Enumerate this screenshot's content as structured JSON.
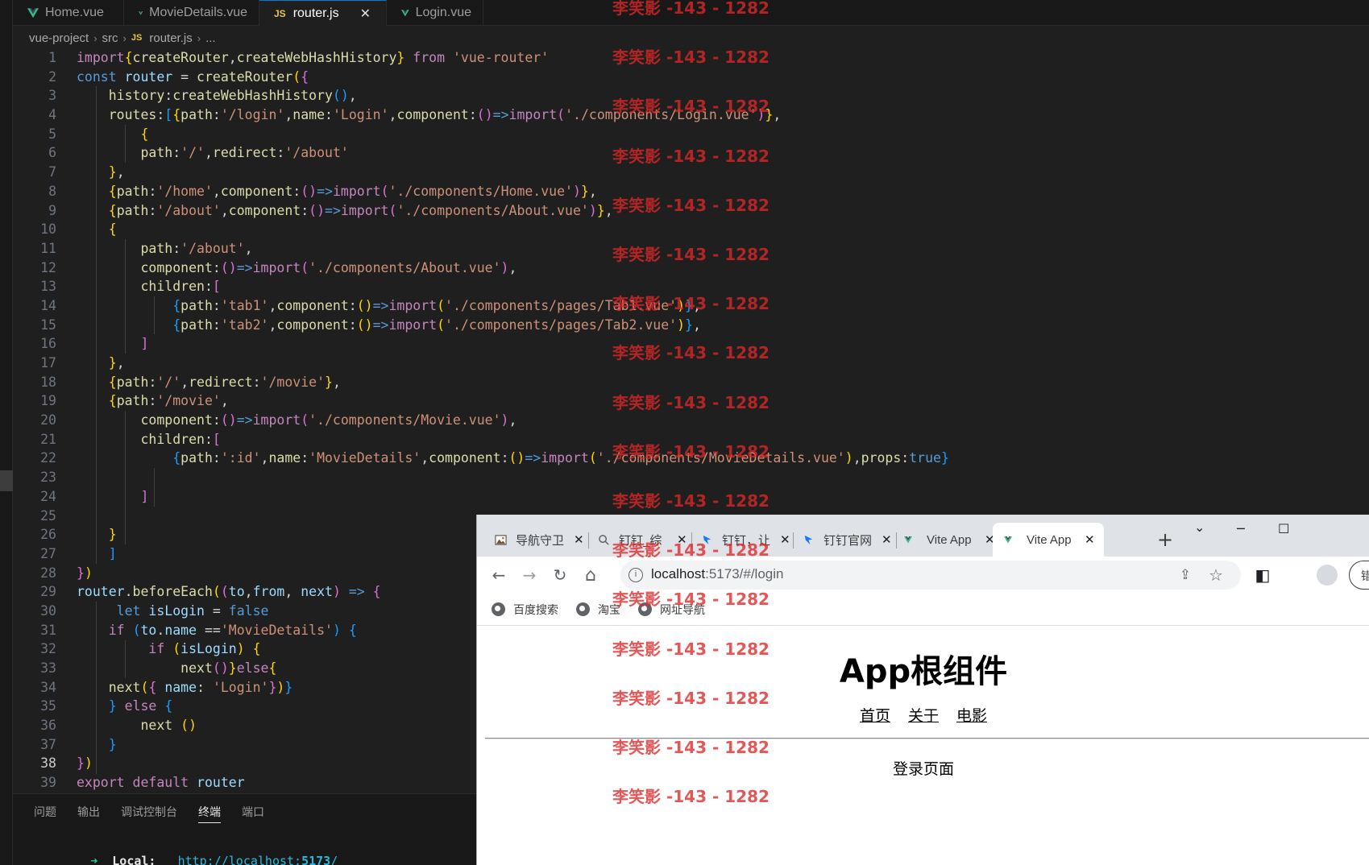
{
  "editor": {
    "tabs": [
      {
        "label": "Home.vue",
        "type": "vue",
        "active": false
      },
      {
        "label": "MovieDetails.vue",
        "type": "vue",
        "active": false
      },
      {
        "label": "router.js",
        "type": "js",
        "active": true
      },
      {
        "label": "Login.vue",
        "type": "vue",
        "active": false
      }
    ],
    "js_badge": "JS",
    "close_glyph": "✕",
    "breadcrumb": [
      "vue-project",
      "src",
      "router.js",
      "..."
    ],
    "breadcrumb_sep": "›",
    "current_line": 38,
    "lines": [
      [
        [
          "kw",
          "import"
        ],
        [
          "p1",
          "{"
        ],
        [
          "fn",
          "createRouter"
        ],
        [
          "op",
          ","
        ],
        [
          "fn",
          "createWebHashHistory"
        ],
        [
          "p1",
          "}"
        ],
        [
          "op",
          " "
        ],
        [
          "kw",
          "from"
        ],
        [
          "op",
          " "
        ],
        [
          "str",
          "'vue-router'"
        ]
      ],
      [
        [
          "var",
          "const"
        ],
        [
          "op",
          " "
        ],
        [
          "v",
          "router"
        ],
        [
          "op",
          " = "
        ],
        [
          "fn",
          "createRouter"
        ],
        [
          "p1",
          "("
        ],
        [
          "p2",
          "{"
        ]
      ],
      [
        [
          "op",
          "    "
        ],
        [
          "fn",
          "history"
        ],
        [
          "op",
          ":"
        ],
        [
          "fn",
          "createWebHashHistory"
        ],
        [
          "p3",
          "()"
        ],
        [
          "op",
          ","
        ]
      ],
      [
        [
          "op",
          "    "
        ],
        [
          "fn",
          "routes"
        ],
        [
          "op",
          ":"
        ],
        [
          "p3",
          "["
        ],
        [
          "p1",
          "{"
        ],
        [
          "fn",
          "path"
        ],
        [
          "op",
          ":"
        ],
        [
          "str",
          "'/login'"
        ],
        [
          "op",
          ","
        ],
        [
          "fn",
          "name"
        ],
        [
          "op",
          ":"
        ],
        [
          "str",
          "'Login'"
        ],
        [
          "op",
          ","
        ],
        [
          "fn",
          "component"
        ],
        [
          "op",
          ":"
        ],
        [
          "p2",
          "()"
        ],
        [
          "ar",
          "=>"
        ],
        [
          "kw",
          "import"
        ],
        [
          "p2",
          "("
        ],
        [
          "str",
          "'./components/Login.vue'"
        ],
        [
          "p2",
          ")"
        ],
        [
          "p1",
          "}"
        ],
        [
          "op",
          ","
        ]
      ],
      [
        [
          "op",
          "        "
        ],
        [
          "p1",
          "{"
        ]
      ],
      [
        [
          "op",
          "        "
        ],
        [
          "fn",
          "path"
        ],
        [
          "op",
          ":"
        ],
        [
          "str",
          "'/'"
        ],
        [
          "op",
          ","
        ],
        [
          "fn",
          "redirect"
        ],
        [
          "op",
          ":"
        ],
        [
          "str",
          "'/about'"
        ]
      ],
      [
        [
          "op",
          "    "
        ],
        [
          "p1",
          "}"
        ],
        [
          "op",
          ","
        ]
      ],
      [
        [
          "op",
          "    "
        ],
        [
          "p1",
          "{"
        ],
        [
          "fn",
          "path"
        ],
        [
          "op",
          ":"
        ],
        [
          "str",
          "'/home'"
        ],
        [
          "op",
          ","
        ],
        [
          "fn",
          "component"
        ],
        [
          "op",
          ":"
        ],
        [
          "p2",
          "()"
        ],
        [
          "ar",
          "=>"
        ],
        [
          "kw",
          "import"
        ],
        [
          "p2",
          "("
        ],
        [
          "str",
          "'./components/Home.vue'"
        ],
        [
          "p2",
          ")"
        ],
        [
          "p1",
          "}"
        ],
        [
          "op",
          ","
        ]
      ],
      [
        [
          "op",
          "    "
        ],
        [
          "p1",
          "{"
        ],
        [
          "fn",
          "path"
        ],
        [
          "op",
          ":"
        ],
        [
          "str",
          "'/about'"
        ],
        [
          "op",
          ","
        ],
        [
          "fn",
          "component"
        ],
        [
          "op",
          ":"
        ],
        [
          "p2",
          "()"
        ],
        [
          "ar",
          "=>"
        ],
        [
          "kw",
          "import"
        ],
        [
          "p2",
          "("
        ],
        [
          "str",
          "'./components/About.vue'"
        ],
        [
          "p2",
          ")"
        ],
        [
          "p1",
          "}"
        ],
        [
          "op",
          ","
        ]
      ],
      [
        [
          "op",
          "    "
        ],
        [
          "p1",
          "{"
        ]
      ],
      [
        [
          "op",
          "        "
        ],
        [
          "fn",
          "path"
        ],
        [
          "op",
          ":"
        ],
        [
          "str",
          "'/about'"
        ],
        [
          "op",
          ","
        ]
      ],
      [
        [
          "op",
          "        "
        ],
        [
          "fn",
          "component"
        ],
        [
          "op",
          ":"
        ],
        [
          "p2",
          "()"
        ],
        [
          "ar",
          "=>"
        ],
        [
          "kw",
          "import"
        ],
        [
          "p2",
          "("
        ],
        [
          "str",
          "'./components/About.vue'"
        ],
        [
          "p2",
          ")"
        ],
        [
          "op",
          ","
        ]
      ],
      [
        [
          "op",
          "        "
        ],
        [
          "fn",
          "children"
        ],
        [
          "op",
          ":"
        ],
        [
          "p2",
          "["
        ]
      ],
      [
        [
          "op",
          "            "
        ],
        [
          "p3",
          "{"
        ],
        [
          "fn",
          "path"
        ],
        [
          "op",
          ":"
        ],
        [
          "str",
          "'tab1'"
        ],
        [
          "op",
          ","
        ],
        [
          "fn",
          "component"
        ],
        [
          "op",
          ":"
        ],
        [
          "p1",
          "()"
        ],
        [
          "ar",
          "=>"
        ],
        [
          "kw",
          "import"
        ],
        [
          "p1",
          "("
        ],
        [
          "str",
          "'./components/pages/Tab1.vue'"
        ],
        [
          "p1",
          ")"
        ],
        [
          "p3",
          "}"
        ],
        [
          "op",
          ","
        ]
      ],
      [
        [
          "op",
          "            "
        ],
        [
          "p3",
          "{"
        ],
        [
          "fn",
          "path"
        ],
        [
          "op",
          ":"
        ],
        [
          "str",
          "'tab2'"
        ],
        [
          "op",
          ","
        ],
        [
          "fn",
          "component"
        ],
        [
          "op",
          ":"
        ],
        [
          "p1",
          "()"
        ],
        [
          "ar",
          "=>"
        ],
        [
          "kw",
          "import"
        ],
        [
          "p1",
          "("
        ],
        [
          "str",
          "'./components/pages/Tab2.vue'"
        ],
        [
          "p1",
          ")"
        ],
        [
          "p3",
          "}"
        ],
        [
          "op",
          ","
        ]
      ],
      [
        [
          "op",
          "        "
        ],
        [
          "p2",
          "]"
        ]
      ],
      [
        [
          "op",
          "    "
        ],
        [
          "p1",
          "}"
        ],
        [
          "op",
          ","
        ]
      ],
      [
        [
          "op",
          "    "
        ],
        [
          "p1",
          "{"
        ],
        [
          "fn",
          "path"
        ],
        [
          "op",
          ":"
        ],
        [
          "str",
          "'/'"
        ],
        [
          "op",
          ","
        ],
        [
          "fn",
          "redirect"
        ],
        [
          "op",
          ":"
        ],
        [
          "str",
          "'/movie'"
        ],
        [
          "p1",
          "}"
        ],
        [
          "op",
          ","
        ]
      ],
      [
        [
          "op",
          "    "
        ],
        [
          "p1",
          "{"
        ],
        [
          "fn",
          "path"
        ],
        [
          "op",
          ":"
        ],
        [
          "str",
          "'/movie'"
        ],
        [
          "op",
          ","
        ]
      ],
      [
        [
          "op",
          "        "
        ],
        [
          "fn",
          "component"
        ],
        [
          "op",
          ":"
        ],
        [
          "p2",
          "()"
        ],
        [
          "ar",
          "=>"
        ],
        [
          "kw",
          "import"
        ],
        [
          "p2",
          "("
        ],
        [
          "str",
          "'./components/Movie.vue'"
        ],
        [
          "p2",
          ")"
        ],
        [
          "op",
          ","
        ]
      ],
      [
        [
          "op",
          "        "
        ],
        [
          "fn",
          "children"
        ],
        [
          "op",
          ":"
        ],
        [
          "p2",
          "["
        ]
      ],
      [
        [
          "op",
          "            "
        ],
        [
          "p3",
          "{"
        ],
        [
          "fn",
          "path"
        ],
        [
          "op",
          ":"
        ],
        [
          "str",
          "':id'"
        ],
        [
          "op",
          ","
        ],
        [
          "fn",
          "name"
        ],
        [
          "op",
          ":"
        ],
        [
          "str",
          "'MovieDetails'"
        ],
        [
          "op",
          ","
        ],
        [
          "fn",
          "component"
        ],
        [
          "op",
          ":"
        ],
        [
          "p1",
          "()"
        ],
        [
          "ar",
          "=>"
        ],
        [
          "kw",
          "import"
        ],
        [
          "p1",
          "("
        ],
        [
          "str",
          "'./components/MovieDetails.vue'"
        ],
        [
          "p1",
          ")"
        ],
        [
          "op",
          ","
        ],
        [
          "fn",
          "props"
        ],
        [
          "op",
          ":"
        ],
        [
          "var",
          "true"
        ],
        [
          "p3",
          "}"
        ]
      ],
      [],
      [
        [
          "op",
          "        "
        ],
        [
          "p2",
          "]"
        ]
      ],
      [],
      [
        [
          "op",
          "    "
        ],
        [
          "p1",
          "}"
        ]
      ],
      [
        [
          "op",
          "    "
        ],
        [
          "p3",
          "]"
        ]
      ],
      [
        [
          "p2",
          "}"
        ],
        [
          "p1",
          ")"
        ]
      ],
      [
        [
          "v",
          "router"
        ],
        [
          "op",
          "."
        ],
        [
          "fn",
          "beforeEach"
        ],
        [
          "p1",
          "("
        ],
        [
          "p2",
          "("
        ],
        [
          "v",
          "to"
        ],
        [
          "op",
          ","
        ],
        [
          "v",
          "from"
        ],
        [
          "op",
          ", "
        ],
        [
          "v",
          "next"
        ],
        [
          "p2",
          ")"
        ],
        [
          "op",
          " "
        ],
        [
          "ar",
          "=>"
        ],
        [
          "op",
          " "
        ],
        [
          "p2",
          "{"
        ]
      ],
      [
        [
          "op",
          "     "
        ],
        [
          "var",
          "let"
        ],
        [
          "op",
          " "
        ],
        [
          "v",
          "isLogin"
        ],
        [
          "op",
          " = "
        ],
        [
          "var",
          "false"
        ]
      ],
      [
        [
          "op",
          "    "
        ],
        [
          "kw",
          "if"
        ],
        [
          "op",
          " "
        ],
        [
          "p3",
          "("
        ],
        [
          "v",
          "to"
        ],
        [
          "op",
          "."
        ],
        [
          "v",
          "name"
        ],
        [
          "op",
          " =="
        ],
        [
          "str",
          "'MovieDetails'"
        ],
        [
          "p3",
          ")"
        ],
        [
          "op",
          " "
        ],
        [
          "p3",
          "{"
        ]
      ],
      [
        [
          "op",
          "         "
        ],
        [
          "kw",
          "if"
        ],
        [
          "op",
          " "
        ],
        [
          "p1",
          "("
        ],
        [
          "v",
          "isLogin"
        ],
        [
          "p1",
          ")"
        ],
        [
          "op",
          " "
        ],
        [
          "p1",
          "{"
        ]
      ],
      [
        [
          "op",
          "             "
        ],
        [
          "fn",
          "next"
        ],
        [
          "p2",
          "()"
        ],
        [
          "p1",
          "}"
        ],
        [
          "kw",
          "else"
        ],
        [
          "p1",
          "{"
        ]
      ],
      [
        [
          "op",
          "    "
        ],
        [
          "fn",
          "next"
        ],
        [
          "p1",
          "("
        ],
        [
          "p2",
          "{"
        ],
        [
          "op",
          " "
        ],
        [
          "v",
          "name"
        ],
        [
          "op",
          ": "
        ],
        [
          "str",
          "'Login'"
        ],
        [
          "p2",
          "}"
        ],
        [
          "p1",
          ")"
        ],
        [
          "p3",
          "}"
        ]
      ],
      [
        [
          "op",
          "    "
        ],
        [
          "p3",
          "}"
        ],
        [
          "op",
          " "
        ],
        [
          "kw",
          "else"
        ],
        [
          "op",
          " "
        ],
        [
          "p3",
          "{"
        ]
      ],
      [
        [
          "op",
          "        "
        ],
        [
          "fn",
          "next"
        ],
        [
          "op",
          " "
        ],
        [
          "p1",
          "()"
        ]
      ],
      [
        [
          "op",
          "    "
        ],
        [
          "p3",
          "}"
        ]
      ],
      [
        [
          "p2",
          "}"
        ],
        [
          "p1",
          ")"
        ]
      ],
      [
        [
          "kw",
          "export"
        ],
        [
          "op",
          " "
        ],
        [
          "kw",
          "default"
        ],
        [
          "op",
          " "
        ],
        [
          "v",
          "router"
        ]
      ]
    ],
    "panel_tabs": [
      "问题",
      "输出",
      "调试控制台",
      "终端",
      "端口"
    ],
    "panel_active_tab": "终端",
    "terminal": {
      "arrow": "➜",
      "label": "Local:",
      "url_prefix": "http://localhost:",
      "port": "5173",
      "url_suffix": "/"
    }
  },
  "browser": {
    "tabs": [
      {
        "title": "导航守卫",
        "favicon": "image-icon"
      },
      {
        "title": "钉钉_综",
        "favicon": "search-icon"
      },
      {
        "title": "钉钉，让",
        "favicon": "dingtalk-icon"
      },
      {
        "title": "钉钉官网",
        "favicon": "dingtalk-icon"
      },
      {
        "title": "Vite App",
        "favicon": "vue-icon"
      },
      {
        "title": "Vite App",
        "favicon": "vue-icon",
        "active": true
      }
    ],
    "tab_close": "✕",
    "new_tab": "+",
    "window_controls": {
      "dropdown": "⌄",
      "minimize": "─",
      "maximize": "☐"
    },
    "nav": {
      "back": "←",
      "forward": "→",
      "reload": "↻",
      "home": "⌂"
    },
    "address": {
      "host": "localhost",
      "rest": ":5173/#/login"
    },
    "toolbar_icons": {
      "share": "⇪",
      "star": "☆",
      "sidepanel": "◧"
    },
    "error_button": "错误",
    "bookmarks": [
      "百度搜索",
      "淘宝",
      "网址导航"
    ],
    "page": {
      "title": "App根组件",
      "nav_links": [
        "首页",
        "关于",
        "电影"
      ],
      "content": "登录页面"
    }
  },
  "watermark": "李笑影 -143 - 1282",
  "colors": {
    "keyword": "#c586c0",
    "declaration": "#569cd6",
    "function": "#dcdcaa",
    "string": "#ce9178",
    "variable": "#9cdcfe",
    "bracket_gold": "#ffd700",
    "bracket_pink": "#da70d6",
    "bracket_blue": "#179fff",
    "watermark": "#dc2828"
  }
}
